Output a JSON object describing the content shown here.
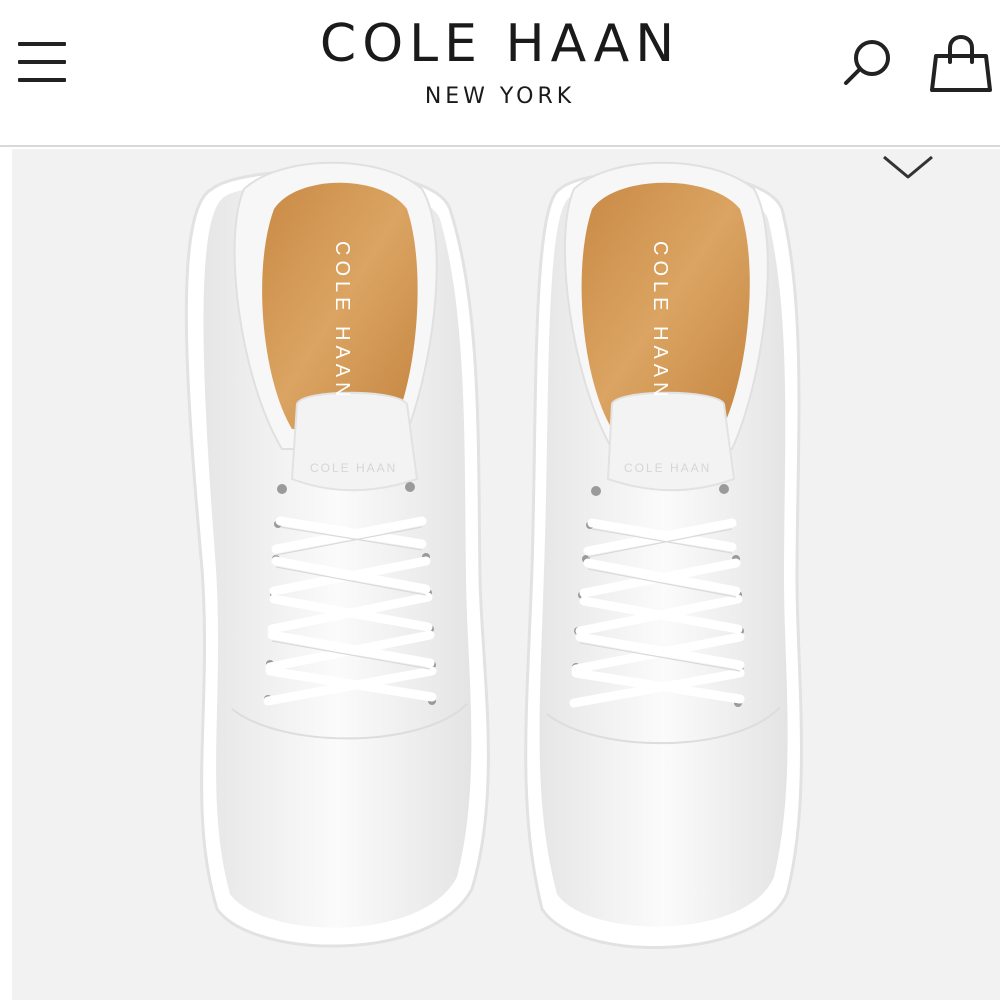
{
  "header": {
    "brand": "COLE HAAN",
    "city": "NEW YORK",
    "menu_icon": "hamburger-menu-icon",
    "search_icon": "search-icon",
    "bag_icon": "shopping-bag-icon"
  },
  "product": {
    "image_alt": "white leather lace-up sneakers, top view",
    "insole_print_left": "COLE HAAN",
    "insole_print_right": "COLE HAAN",
    "tongue_print_left": "COLE HAAN",
    "tongue_print_right": "COLE HAAN",
    "chevron_icon": "chevron-down-icon"
  },
  "colors": {
    "header_bg": "#ffffff",
    "text": "#1a1a1a",
    "divider": "#d8d8d8",
    "image_bg": "#f2f2f2",
    "insole": "#d49a52"
  }
}
